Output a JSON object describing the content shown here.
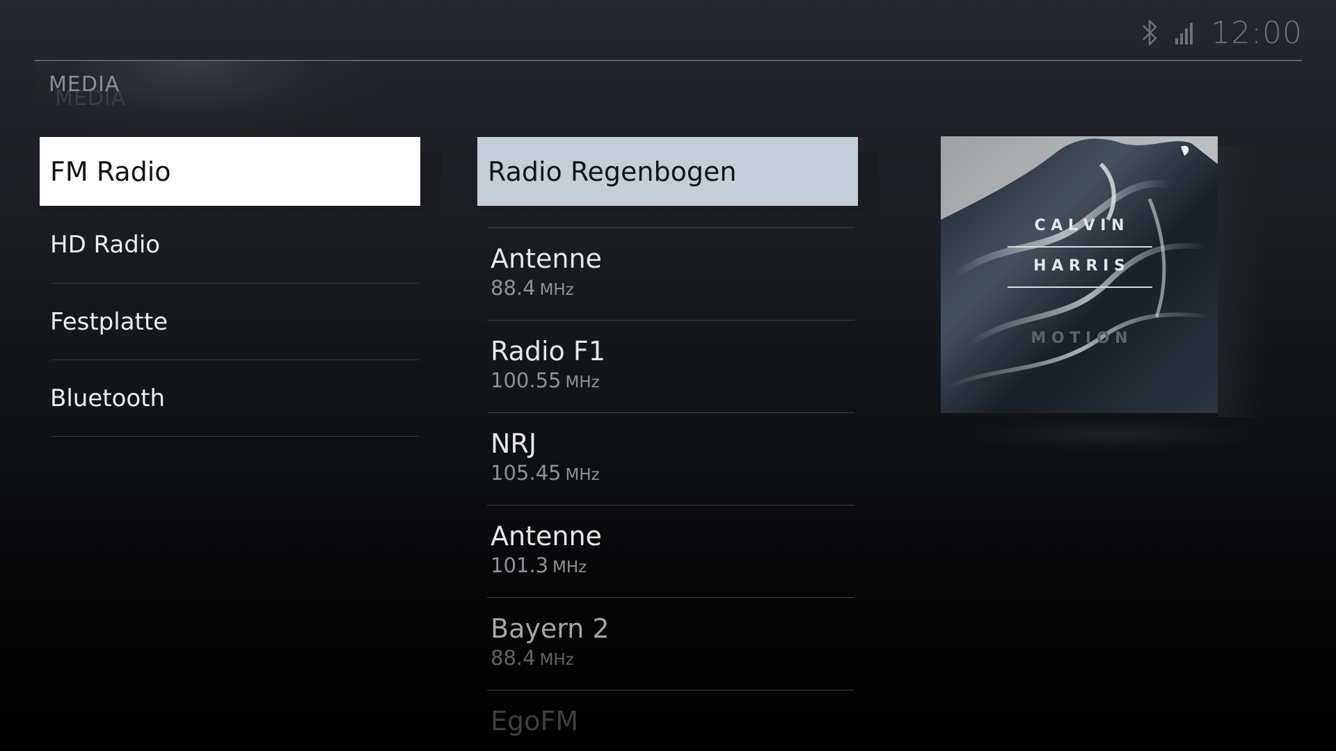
{
  "status_bar": {
    "clock": "12:00",
    "icons": [
      "bluetooth-icon",
      "signal-strength-icon"
    ]
  },
  "section_title": "MEDIA",
  "sources": [
    {
      "label": "FM Radio",
      "active": true
    },
    {
      "label": "HD Radio",
      "active": false
    },
    {
      "label": "Festplatte",
      "active": false
    },
    {
      "label": "Bluetooth",
      "active": false
    }
  ],
  "current_station": "Radio Regenbogen",
  "stations": [
    {
      "name": "Antenne",
      "freq": "88.4",
      "unit": "MHz"
    },
    {
      "name": "Radio F1",
      "freq": "100.55",
      "unit": "MHz"
    },
    {
      "name": "NRJ",
      "freq": "105.45",
      "unit": "MHz"
    },
    {
      "name": "Antenne",
      "freq": "101.3",
      "unit": "MHz"
    },
    {
      "name": "Bayern 2",
      "freq": "88.4",
      "unit": "MHz"
    },
    {
      "name": "EgoFM",
      "freq": "",
      "unit": ""
    }
  ],
  "album": {
    "artist_line1": "C A L V I N",
    "artist_line2": "H A R R I S",
    "title": "M O T I O N"
  },
  "colors": {
    "active_source_bg": "#ffffff",
    "active_station_bg": "#c4ced9",
    "background_top": "#24272c",
    "background_bottom": "#000000"
  }
}
